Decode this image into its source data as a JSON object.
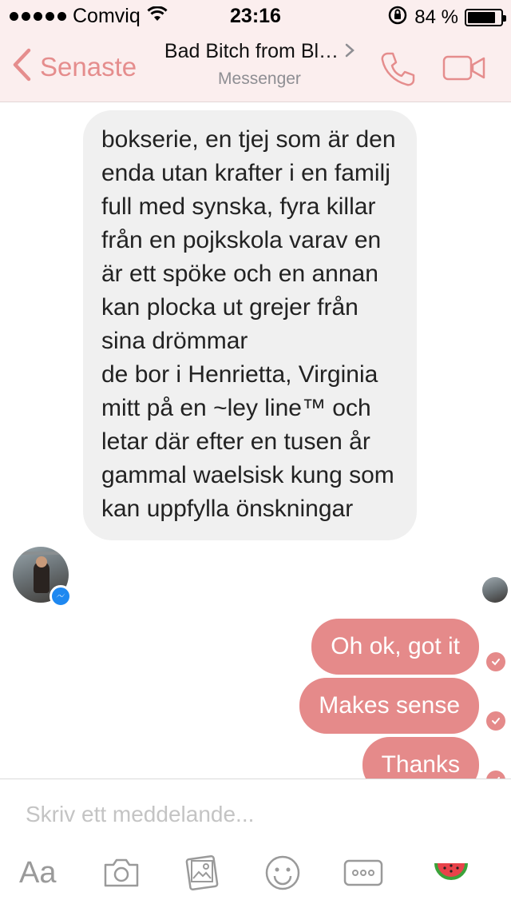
{
  "status_bar": {
    "carrier": "Comviq",
    "time": "23:16",
    "battery_percent": "84 %",
    "battery_level": 0.84
  },
  "nav": {
    "back_label": "Senaste",
    "title": "Bad Bitch from Bl…",
    "subtitle": "Messenger",
    "accent_color": "#e58d8d",
    "icons": [
      "chevron-left-icon",
      "chevron-right-icon",
      "phone-icon",
      "video-camera-icon"
    ]
  },
  "messages": {
    "incoming_text": "bokserie, en tjej som är den enda utan krafter i en familj full med synska, fyra killar från en pojkskola varav en är ett spöke och en annan kan plocka ut grejer från sina drömmar\nde bor i Henrietta, Virginia mitt på en ~ley line™ och letar där efter en tusen år gammal waelsisk kung som kan uppfylla önskningar",
    "outgoing": [
      "Oh ok, got it",
      "Makes sense",
      "Thanks"
    ],
    "outgoing_color": "#e58a8a",
    "incoming_bg": "#f0f0f0"
  },
  "composer": {
    "placeholder": "Skriv ett meddelande...",
    "aa_label": "Aa",
    "icons": [
      "text-format-icon",
      "camera-icon",
      "photo-gallery-icon",
      "emoji-icon",
      "more-icon",
      "watermelon-icon"
    ]
  }
}
